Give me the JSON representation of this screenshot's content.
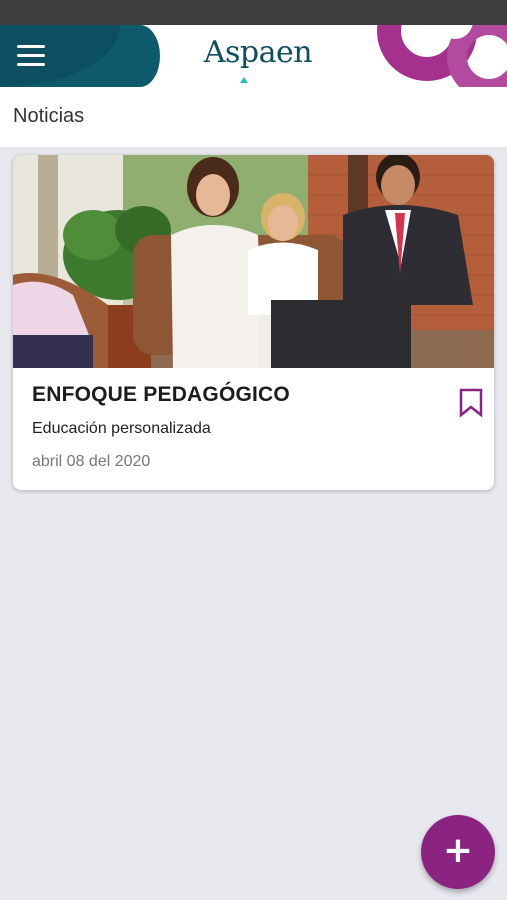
{
  "header": {
    "logo_text": "Aspaen",
    "menu_icon": "hamburger-menu-icon"
  },
  "page": {
    "title": "Noticias"
  },
  "news": [
    {
      "title": "ENFOQUE PEDAGÓGICO",
      "subtitle": "Educación personalizada",
      "date": "abril 08 del 2020",
      "bookmark_icon": "bookmark-outline-icon"
    }
  ],
  "fab": {
    "label": "+",
    "icon": "plus-icon"
  },
  "colors": {
    "header_teal": "#0e5a6c",
    "accent_purple": "#8a2480",
    "background": "#e8e8ef"
  }
}
